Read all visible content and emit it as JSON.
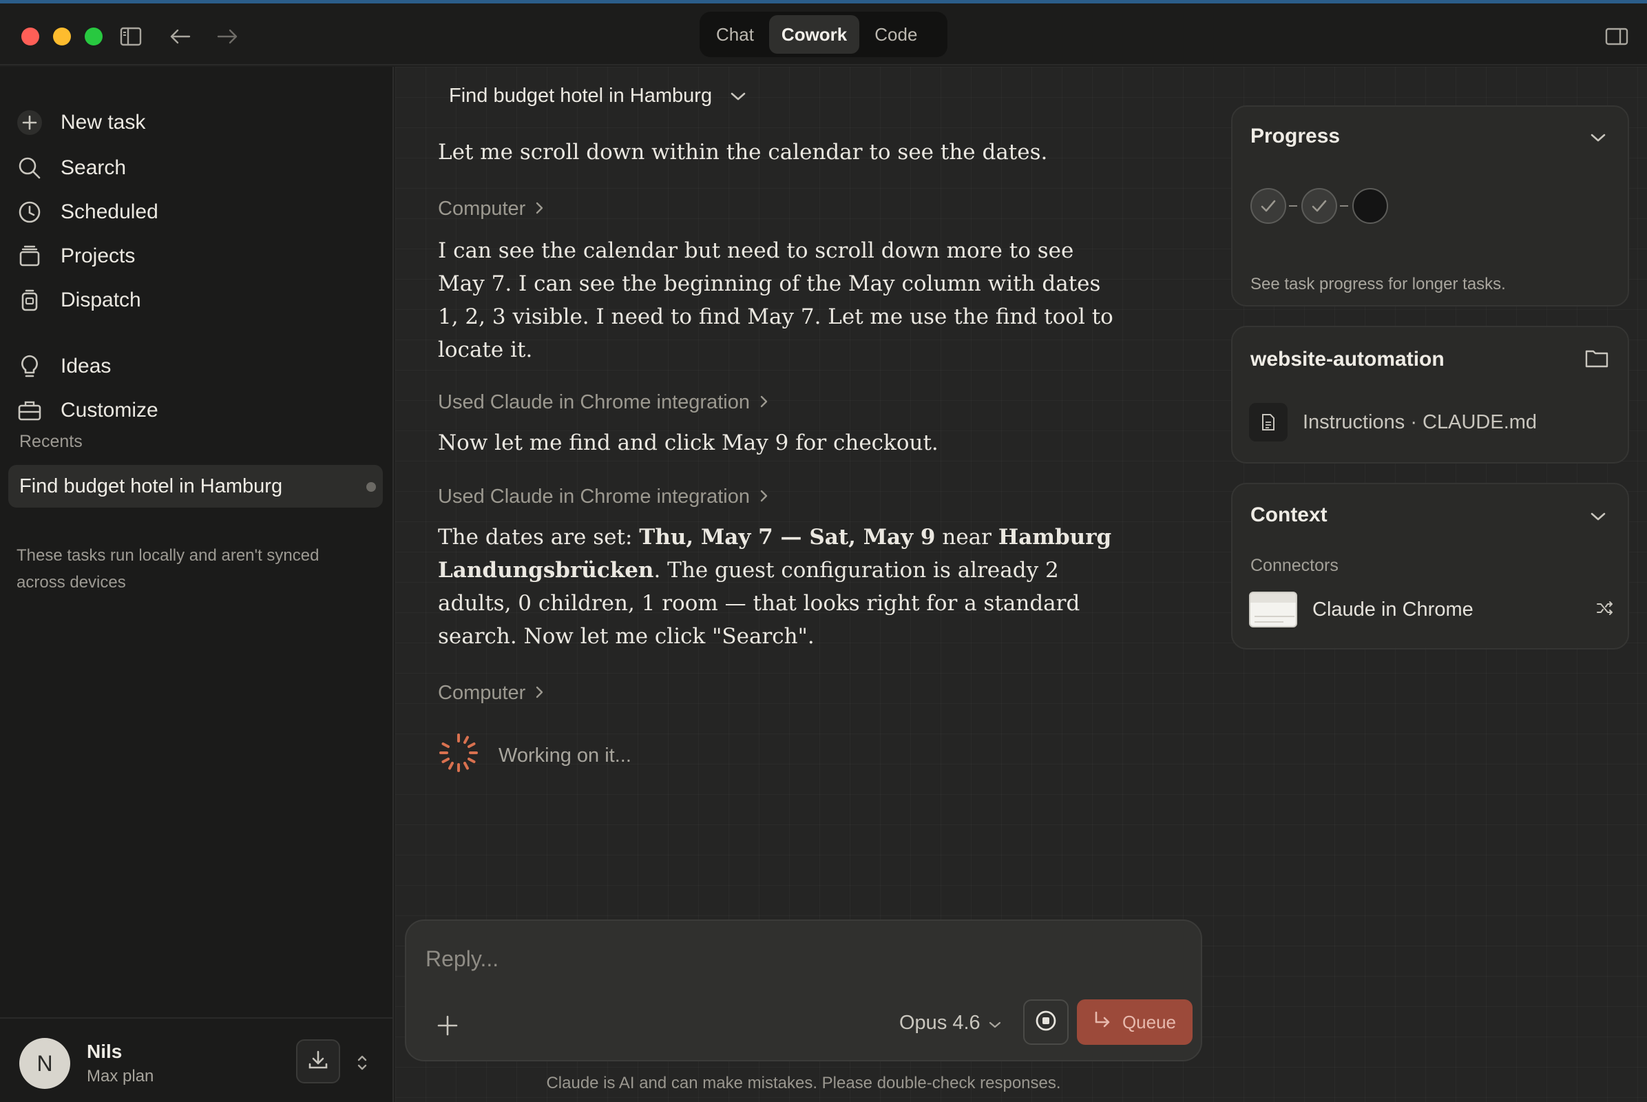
{
  "titlebar": {
    "tabs": [
      "Chat",
      "Cowork",
      "Code"
    ],
    "active_tab": "Cowork"
  },
  "sidebar": {
    "nav": [
      {
        "label": "New task",
        "icon": "plus-icon"
      },
      {
        "label": "Search",
        "icon": "search-icon"
      },
      {
        "label": "Scheduled",
        "icon": "clock-icon"
      },
      {
        "label": "Projects",
        "icon": "projects-icon"
      },
      {
        "label": "Dispatch",
        "icon": "dispatch-icon"
      },
      {
        "label": "Ideas",
        "icon": "lightbulb-icon"
      },
      {
        "label": "Customize",
        "icon": "toolbox-icon"
      }
    ],
    "recents_label": "Recents",
    "recents": [
      "Find budget hotel in Hamburg"
    ],
    "local_note": "These tasks run locally and aren't synced across devices",
    "user": {
      "initial": "N",
      "name": "Nils",
      "plan": "Max plan"
    }
  },
  "main": {
    "task_title": "Find budget hotel in Hamburg",
    "messages": {
      "m1": "Let me scroll down within the calendar to see the dates.",
      "tool1": "Computer",
      "m2": "I can see the calendar but need to scroll down more to see May 7. I can see the beginning of the May column with dates 1, 2, 3 visible. I need to find May 7. Let me use the find tool to locate it.",
      "tool2": "Used Claude in Chrome integration",
      "m3": "Now let me find and click May 9 for checkout.",
      "tool3": "Used Claude in Chrome integration",
      "m4_a": "The dates are set: ",
      "m4_b": "Thu, May 7 — Sat, May 9",
      "m4_c": " near ",
      "m4_d": "Hamburg Landungsbrücken",
      "m4_e": ". The guest configuration is already 2 adults, 0 children, 1 room — that looks right for a standard search. Now let me click \"Search\".",
      "tool4": "Computer",
      "working": "Working on it..."
    },
    "composer": {
      "placeholder": "Reply...",
      "model": "Opus 4.6",
      "queue_label": "Queue"
    },
    "disclaimer": "Claude is AI and can make mistakes. Please double-check responses."
  },
  "right": {
    "progress": {
      "title": "Progress",
      "steps": [
        "done",
        "done",
        "current"
      ],
      "note": "See task progress for longer tasks."
    },
    "folder": {
      "title": "website-automation",
      "file_label": "Instructions · CLAUDE.md"
    },
    "context": {
      "title": "Context",
      "subtitle": "Connectors",
      "connector": "Claude in Chrome"
    }
  },
  "colors": {
    "accent_queue": "#9c4a3a",
    "spinner": "#d9714f",
    "background": "#252524"
  }
}
